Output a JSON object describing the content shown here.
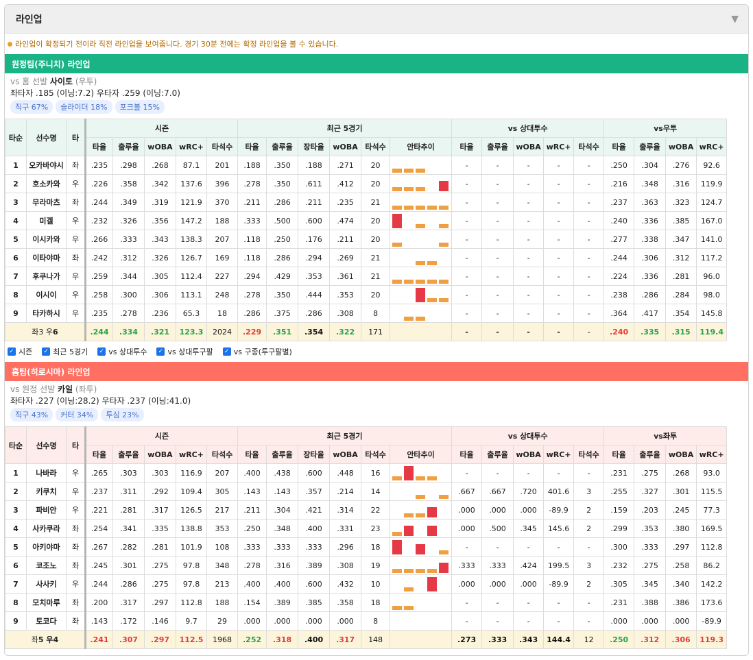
{
  "panel": {
    "title": "라인업",
    "toggle_icon": "caret-down-icon"
  },
  "notice": "라인업이 확정되기 전이라 직전 라인업을 보여줍니다. 경기 30분 전에는 확정 라인업을 볼 수 있습니다.",
  "colors": {
    "away": "#19b386",
    "home": "#ff7062",
    "bar_orange": "#f0a040",
    "bar_red": "#e63946"
  },
  "headers": {
    "order": "타순",
    "name": "선수명",
    "hand": "타",
    "groups": [
      "시즌",
      "최근 5경기"
    ],
    "vs_pitcher": "vs 상대투수",
    "season_cols": [
      "타율",
      "출루율",
      "wOBA",
      "wRC+",
      "타석수"
    ],
    "recent_cols": [
      "타율",
      "출루율",
      "장타율",
      "wOBA",
      "타석수",
      "안타추이"
    ],
    "vsp_cols": [
      "타율",
      "출루율",
      "wOBA",
      "wRC+",
      "타석수"
    ],
    "split_cols": [
      "타율",
      "출루율",
      "wOBA",
      "wRC+"
    ]
  },
  "away": {
    "bar_title": "원정팀(주니치) 라인업",
    "pitcher_line_prefix": "vs 홈 선발",
    "pitcher_name": "사이토",
    "pitcher_hand": "(우투)",
    "split_line": "좌타자 .185 (이닝:7.2)  우타자 .259 (이닝:7.0)",
    "chips": [
      "직구 67%",
      "슬라이더 18%",
      "포크볼 15%"
    ],
    "split_group": "vs우투",
    "rows": [
      {
        "o": "1",
        "n": "오카바야시",
        "h": "좌",
        "s": [
          ".235",
          ".298",
          ".268",
          "87.1",
          "201"
        ],
        "r": [
          ".188",
          ".350",
          ".188",
          ".271",
          "20"
        ],
        "bars": [
          [
            "o",
            1
          ],
          [
            "o",
            1
          ],
          [
            "o",
            1
          ],
          [
            "n",
            0
          ],
          [
            "n",
            0
          ]
        ],
        "v": [
          "-",
          "-",
          "-",
          "-",
          "-"
        ],
        "p": [
          ".250",
          ".304",
          ".276",
          "92.6"
        ]
      },
      {
        "o": "2",
        "n": "호소카와",
        "h": "우",
        "s": [
          ".226",
          ".358",
          ".342",
          "137.6",
          "396"
        ],
        "r": [
          ".278",
          ".350",
          ".611",
          ".412",
          "20"
        ],
        "bars": [
          [
            "o",
            1
          ],
          [
            "o",
            1
          ],
          [
            "o",
            1
          ],
          [
            "n",
            0
          ],
          [
            "r",
            2
          ]
        ],
        "v": [
          "-",
          "-",
          "-",
          "-",
          "-"
        ],
        "p": [
          ".216",
          ".348",
          ".316",
          "119.9"
        ]
      },
      {
        "o": "3",
        "n": "무라마츠",
        "h": "좌",
        "s": [
          ".244",
          ".349",
          ".319",
          "121.9",
          "370"
        ],
        "r": [
          ".211",
          ".286",
          ".211",
          ".235",
          "21"
        ],
        "bars": [
          [
            "o",
            1
          ],
          [
            "o",
            1
          ],
          [
            "o",
            1
          ],
          [
            "o",
            1
          ],
          [
            "o",
            1
          ]
        ],
        "v": [
          "-",
          "-",
          "-",
          "-",
          "-"
        ],
        "p": [
          ".237",
          ".363",
          ".323",
          "124.7"
        ]
      },
      {
        "o": "4",
        "n": "미겔",
        "h": "우",
        "s": [
          ".232",
          ".326",
          ".356",
          "147.2",
          "188"
        ],
        "r": [
          ".333",
          ".500",
          ".600",
          ".474",
          "20"
        ],
        "bars": [
          [
            "r",
            3
          ],
          [
            "n",
            0
          ],
          [
            "o",
            1
          ],
          [
            "n",
            0
          ],
          [
            "o",
            1
          ]
        ],
        "v": [
          "-",
          "-",
          "-",
          "-",
          "-"
        ],
        "p": [
          ".240",
          ".336",
          ".385",
          "167.0"
        ]
      },
      {
        "o": "5",
        "n": "이시카와",
        "h": "우",
        "s": [
          ".266",
          ".333",
          ".343",
          "138.3",
          "207"
        ],
        "r": [
          ".118",
          ".250",
          ".176",
          ".211",
          "20"
        ],
        "bars": [
          [
            "o",
            1
          ],
          [
            "n",
            0
          ],
          [
            "n",
            0
          ],
          [
            "n",
            0
          ],
          [
            "o",
            1
          ]
        ],
        "v": [
          "-",
          "-",
          "-",
          "-",
          "-"
        ],
        "p": [
          ".277",
          ".338",
          ".347",
          "141.0"
        ]
      },
      {
        "o": "6",
        "n": "이타야마",
        "h": "좌",
        "s": [
          ".242",
          ".312",
          ".326",
          "126.7",
          "169"
        ],
        "r": [
          ".118",
          ".286",
          ".294",
          ".269",
          "21"
        ],
        "bars": [
          [
            "n",
            0
          ],
          [
            "n",
            0
          ],
          [
            "o",
            1
          ],
          [
            "o",
            1
          ],
          [
            "n",
            0
          ]
        ],
        "v": [
          "-",
          "-",
          "-",
          "-",
          "-"
        ],
        "p": [
          ".244",
          ".306",
          ".312",
          "117.2"
        ]
      },
      {
        "o": "7",
        "n": "후쿠나가",
        "h": "우",
        "s": [
          ".259",
          ".344",
          ".305",
          "112.4",
          "227"
        ],
        "r": [
          ".294",
          ".429",
          ".353",
          ".361",
          "21"
        ],
        "bars": [
          [
            "o",
            1
          ],
          [
            "o",
            1
          ],
          [
            "o",
            1
          ],
          [
            "o",
            1
          ],
          [
            "o",
            1
          ]
        ],
        "v": [
          "-",
          "-",
          "-",
          "-",
          "-"
        ],
        "p": [
          ".224",
          ".336",
          ".281",
          "96.0"
        ]
      },
      {
        "o": "8",
        "n": "이시이",
        "h": "우",
        "s": [
          ".258",
          ".300",
          ".306",
          "113.1",
          "248"
        ],
        "r": [
          ".278",
          ".350",
          ".444",
          ".353",
          "20"
        ],
        "bars": [
          [
            "n",
            0
          ],
          [
            "n",
            0
          ],
          [
            "r",
            3
          ],
          [
            "o",
            1
          ],
          [
            "o",
            1
          ]
        ],
        "v": [
          "-",
          "-",
          "-",
          "-",
          "-"
        ],
        "p": [
          ".238",
          ".286",
          ".284",
          "98.0"
        ]
      },
      {
        "o": "9",
        "n": "타카하시",
        "h": "우",
        "s": [
          ".235",
          ".278",
          ".236",
          "65.3",
          "18"
        ],
        "r": [
          ".286",
          ".375",
          ".286",
          ".308",
          "8"
        ],
        "bars": [
          [
            "n",
            0
          ],
          [
            "o",
            1
          ],
          [
            "o",
            1
          ],
          [
            "n",
            0
          ],
          [
            "n",
            0
          ]
        ],
        "v": [
          "-",
          "-",
          "-",
          "-",
          "-"
        ],
        "p": [
          ".364",
          ".417",
          ".354",
          "145.8"
        ]
      }
    ],
    "foot": {
      "label_a": "좌3 우",
      "label_b": "6",
      "s": [
        ".244",
        ".334",
        ".321",
        "123.3",
        "2024"
      ],
      "r": [
        ".229",
        ".351",
        ".354",
        ".322",
        "171"
      ],
      "v": [
        "-",
        "-",
        "-",
        "-",
        "-"
      ],
      "p": [
        ".240",
        ".335",
        ".315",
        "119.4"
      ]
    }
  },
  "filters": [
    "시즌",
    "최근 5경기",
    "vs 상대투수",
    "vs 상대투구팔",
    "vs 구종(투구팔별)"
  ],
  "home": {
    "bar_title": "홈팀(히로시마) 라인업",
    "pitcher_line_prefix": "vs 원정 선발",
    "pitcher_name": "카일",
    "pitcher_hand": "(좌투)",
    "split_line": "좌타자 .227 (이닝:28.2)  우타자 .237 (이닝:41.0)",
    "chips": [
      "직구 43%",
      "커터 34%",
      "투심 23%"
    ],
    "split_group": "vs좌투",
    "rows": [
      {
        "o": "1",
        "n": "나바라",
        "h": "우",
        "s": [
          ".265",
          ".303",
          ".303",
          "116.9",
          "207"
        ],
        "r": [
          ".400",
          ".438",
          ".600",
          ".448",
          "16"
        ],
        "bars": [
          [
            "o",
            1
          ],
          [
            "r",
            3
          ],
          [
            "o",
            1
          ],
          [
            "o",
            1
          ],
          [
            "n",
            0
          ]
        ],
        "v": [
          "-",
          "-",
          "-",
          "-",
          "-"
        ],
        "p": [
          ".231",
          ".275",
          ".268",
          "93.0"
        ]
      },
      {
        "o": "2",
        "n": "키쿠치",
        "h": "우",
        "s": [
          ".237",
          ".311",
          ".292",
          "109.4",
          "305"
        ],
        "r": [
          ".143",
          ".143",
          ".357",
          ".214",
          "14"
        ],
        "bars": [
          [
            "n",
            0
          ],
          [
            "n",
            0
          ],
          [
            "o",
            1
          ],
          [
            "n",
            0
          ],
          [
            "o",
            1
          ]
        ],
        "v": [
          ".667",
          ".667",
          ".720",
          "401.6",
          "3"
        ],
        "p": [
          ".255",
          ".327",
          ".301",
          "115.5"
        ]
      },
      {
        "o": "3",
        "n": "파비안",
        "h": "우",
        "s": [
          ".221",
          ".281",
          ".317",
          "126.5",
          "217"
        ],
        "r": [
          ".211",
          ".304",
          ".421",
          ".314",
          "22"
        ],
        "bars": [
          [
            "n",
            0
          ],
          [
            "o",
            1
          ],
          [
            "o",
            1
          ],
          [
            "r",
            2
          ],
          [
            "n",
            0
          ]
        ],
        "v": [
          ".000",
          ".000",
          ".000",
          "-89.9",
          "2"
        ],
        "p": [
          ".159",
          ".203",
          ".245",
          "77.3"
        ]
      },
      {
        "o": "4",
        "n": "사카쿠라",
        "h": "좌",
        "s": [
          ".254",
          ".341",
          ".335",
          "138.8",
          "353"
        ],
        "r": [
          ".250",
          ".348",
          ".400",
          ".331",
          "23"
        ],
        "bars": [
          [
            "o",
            1
          ],
          [
            "r",
            2
          ],
          [
            "n",
            0
          ],
          [
            "r",
            2
          ],
          [
            "n",
            0
          ]
        ],
        "v": [
          ".000",
          ".500",
          ".345",
          "145.6",
          "2"
        ],
        "p": [
          ".299",
          ".353",
          ".380",
          "169.5"
        ]
      },
      {
        "o": "5",
        "n": "아키야마",
        "h": "좌",
        "s": [
          ".267",
          ".282",
          ".281",
          "101.9",
          "108"
        ],
        "r": [
          ".333",
          ".333",
          ".333",
          ".296",
          "18"
        ],
        "bars": [
          [
            "r",
            3
          ],
          [
            "n",
            0
          ],
          [
            "r",
            2
          ],
          [
            "n",
            0
          ],
          [
            "o",
            1
          ]
        ],
        "v": [
          "-",
          "-",
          "-",
          "-",
          "-"
        ],
        "p": [
          ".300",
          ".333",
          ".297",
          "112.8"
        ]
      },
      {
        "o": "6",
        "n": "코조노",
        "h": "좌",
        "s": [
          ".245",
          ".301",
          ".275",
          "97.8",
          "348"
        ],
        "r": [
          ".278",
          ".316",
          ".389",
          ".308",
          "19"
        ],
        "bars": [
          [
            "o",
            1
          ],
          [
            "o",
            1
          ],
          [
            "o",
            1
          ],
          [
            "o",
            1
          ],
          [
            "r",
            2
          ]
        ],
        "v": [
          ".333",
          ".333",
          ".424",
          "199.5",
          "3"
        ],
        "p": [
          ".232",
          ".275",
          ".258",
          "86.2"
        ]
      },
      {
        "o": "7",
        "n": "사사키",
        "h": "우",
        "s": [
          ".244",
          ".286",
          ".275",
          "97.8",
          "213"
        ],
        "r": [
          ".400",
          ".400",
          ".600",
          ".432",
          "10"
        ],
        "bars": [
          [
            "n",
            0
          ],
          [
            "o",
            1
          ],
          [
            "n",
            0
          ],
          [
            "r",
            3
          ],
          [
            "n",
            0
          ]
        ],
        "v": [
          ".000",
          ".000",
          ".000",
          "-89.9",
          "2"
        ],
        "p": [
          ".305",
          ".345",
          ".340",
          "142.2"
        ]
      },
      {
        "o": "8",
        "n": "모치마루",
        "h": "좌",
        "s": [
          ".200",
          ".317",
          ".297",
          "112.8",
          "188"
        ],
        "r": [
          ".154",
          ".389",
          ".385",
          ".358",
          "18"
        ],
        "bars": [
          [
            "o",
            1
          ],
          [
            "o",
            1
          ],
          [
            "n",
            0
          ],
          [
            "n",
            0
          ],
          [
            "n",
            0
          ]
        ],
        "v": [
          "-",
          "-",
          "-",
          "-",
          "-"
        ],
        "p": [
          ".231",
          ".388",
          ".386",
          "173.6"
        ]
      },
      {
        "o": "9",
        "n": "토코다",
        "h": "좌",
        "s": [
          ".143",
          ".172",
          ".146",
          "9.7",
          "29"
        ],
        "r": [
          ".000",
          ".000",
          ".000",
          ".000",
          "8"
        ],
        "bars": [
          [
            "n",
            0
          ],
          [
            "n",
            0
          ],
          [
            "n",
            0
          ],
          [
            "n",
            0
          ],
          [
            "n",
            0
          ]
        ],
        "v": [
          "-",
          "-",
          "-",
          "-",
          "-"
        ],
        "p": [
          ".000",
          ".000",
          ".000",
          "-89.9"
        ]
      }
    ],
    "foot": {
      "label_a": "좌",
      "label_b": "5 우4",
      "s": [
        ".241",
        ".307",
        ".297",
        "112.5",
        "1968"
      ],
      "r": [
        ".252",
        ".318",
        ".400",
        ".317",
        "148"
      ],
      "v": [
        ".273",
        ".333",
        ".343",
        "144.4",
        "12"
      ],
      "p": [
        ".250",
        ".312",
        ".306",
        "119.3"
      ]
    }
  }
}
